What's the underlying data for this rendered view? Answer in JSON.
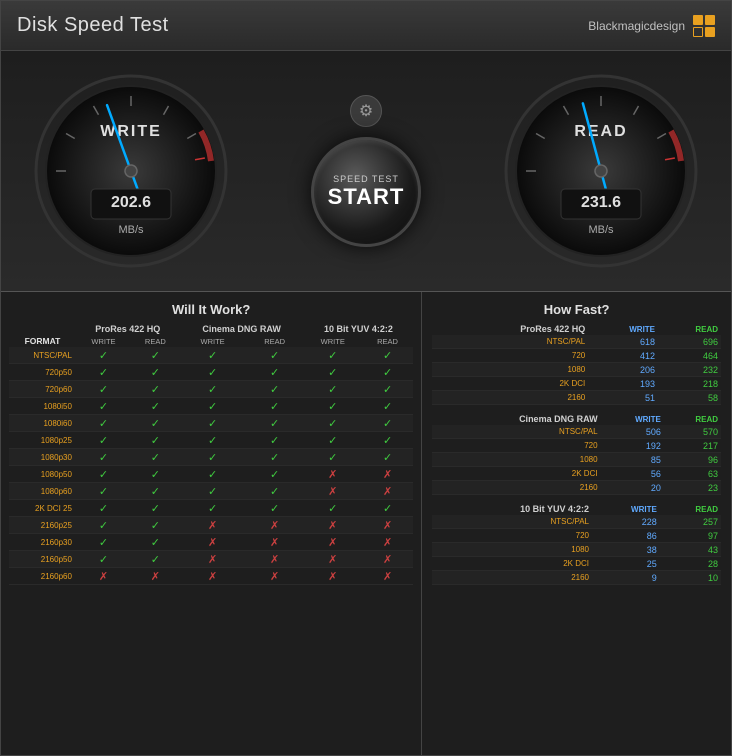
{
  "window": {
    "title": "Disk Speed Test",
    "brand": "Blackmagicdesign"
  },
  "gauges": {
    "write": {
      "label": "WRITE",
      "value": "202.6",
      "unit": "MB/s",
      "needle_angle": -20
    },
    "read": {
      "label": "READ",
      "value": "231.6",
      "unit": "MB/s",
      "needle_angle": -15
    }
  },
  "start_button": {
    "top_label": "SPEED TEST",
    "main_label": "START"
  },
  "will_it_work": {
    "title": "Will It Work?",
    "codecs": [
      "ProRes 422 HQ",
      "Cinema DNG RAW",
      "10 Bit YUV 4:2:2"
    ],
    "subheaders": [
      "WRITE",
      "READ"
    ],
    "formats": [
      {
        "name": "FORMAT",
        "label_only": true
      },
      {
        "name": "NTSC/PAL",
        "prores": [
          "✓",
          "✓"
        ],
        "dng": [
          "✓",
          "✓"
        ],
        "yuv": [
          "✓",
          "✓"
        ]
      },
      {
        "name": "720p50",
        "prores": [
          "✓",
          "✓"
        ],
        "dng": [
          "✓",
          "✓"
        ],
        "yuv": [
          "✓",
          "✓"
        ]
      },
      {
        "name": "720p60",
        "prores": [
          "✓",
          "✓"
        ],
        "dng": [
          "✓",
          "✓"
        ],
        "yuv": [
          "✓",
          "✓"
        ]
      },
      {
        "name": "1080i50",
        "prores": [
          "✓",
          "✓"
        ],
        "dng": [
          "✓",
          "✓"
        ],
        "yuv": [
          "✓",
          "✓"
        ]
      },
      {
        "name": "1080i60",
        "prores": [
          "✓",
          "✓"
        ],
        "dng": [
          "✓",
          "✓"
        ],
        "yuv": [
          "✓",
          "✓"
        ]
      },
      {
        "name": "1080p25",
        "prores": [
          "✓",
          "✓"
        ],
        "dng": [
          "✓",
          "✓"
        ],
        "yuv": [
          "✓",
          "✓"
        ]
      },
      {
        "name": "1080p30",
        "prores": [
          "✓",
          "✓"
        ],
        "dng": [
          "✓",
          "✓"
        ],
        "yuv": [
          "✓",
          "✓"
        ]
      },
      {
        "name": "1080p50",
        "prores": [
          "✓",
          "✓"
        ],
        "dng": [
          "✓",
          "✓"
        ],
        "yuv": [
          "✗",
          "✗"
        ]
      },
      {
        "name": "1080p60",
        "prores": [
          "✓",
          "✓"
        ],
        "dng": [
          "✓",
          "✓"
        ],
        "yuv": [
          "✗",
          "✗"
        ]
      },
      {
        "name": "2K DCI 25",
        "prores": [
          "✓",
          "✓"
        ],
        "dng": [
          "✓",
          "✓"
        ],
        "yuv": [
          "✓",
          "✓"
        ]
      },
      {
        "name": "2160p25",
        "prores": [
          "✓",
          "✓"
        ],
        "dng": [
          "✗",
          "✗"
        ],
        "yuv": [
          "✗",
          "✗"
        ]
      },
      {
        "name": "2160p30",
        "prores": [
          "✓",
          "✓"
        ],
        "dng": [
          "✗",
          "✗"
        ],
        "yuv": [
          "✗",
          "✗"
        ]
      },
      {
        "name": "2160p50",
        "prores": [
          "✓",
          "✓"
        ],
        "dng": [
          "✗",
          "✗"
        ],
        "yuv": [
          "✗",
          "✗"
        ]
      },
      {
        "name": "2160p60",
        "prores": [
          "✗",
          "✗"
        ],
        "dng": [
          "✗",
          "✗"
        ],
        "yuv": [
          "✗",
          "✗"
        ]
      }
    ]
  },
  "how_fast": {
    "title": "How Fast?",
    "sections": [
      {
        "codec": "ProRes 422 HQ",
        "rows": [
          {
            "format": "NTSC/PAL",
            "write": 618,
            "read": 696
          },
          {
            "format": "720",
            "write": 412,
            "read": 464
          },
          {
            "format": "1080",
            "write": 206,
            "read": 232
          },
          {
            "format": "2K DCI",
            "write": 193,
            "read": 218
          },
          {
            "format": "2160",
            "write": 51,
            "read": 58
          }
        ]
      },
      {
        "codec": "Cinema DNG RAW",
        "rows": [
          {
            "format": "NTSC/PAL",
            "write": 506,
            "read": 570
          },
          {
            "format": "720",
            "write": 192,
            "read": 217
          },
          {
            "format": "1080",
            "write": 85,
            "read": 96
          },
          {
            "format": "2K DCI",
            "write": 56,
            "read": 63
          },
          {
            "format": "2160",
            "write": 20,
            "read": 23
          }
        ]
      },
      {
        "codec": "10 Bit YUV 4:2:2",
        "rows": [
          {
            "format": "NTSC/PAL",
            "write": 228,
            "read": 257
          },
          {
            "format": "720",
            "write": 86,
            "read": 97
          },
          {
            "format": "1080",
            "write": 38,
            "read": 43
          },
          {
            "format": "2K DCI",
            "write": 25,
            "read": 28
          },
          {
            "format": "2160",
            "write": 9,
            "read": 10
          }
        ]
      }
    ]
  }
}
